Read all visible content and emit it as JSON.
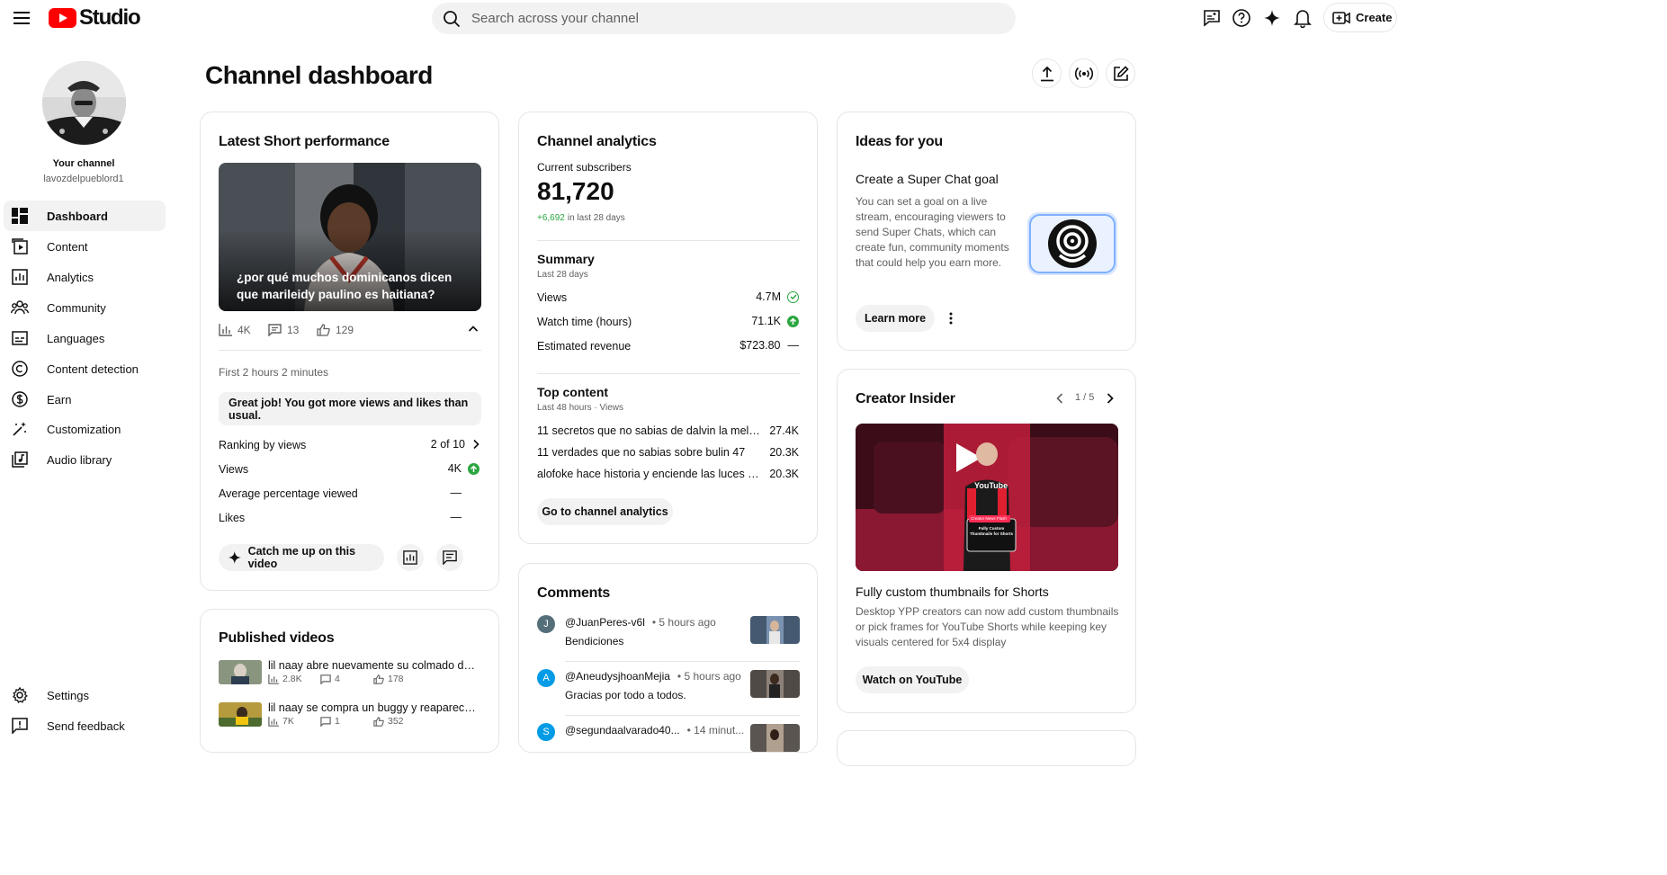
{
  "app": {
    "logo_text": "Studio"
  },
  "search": {
    "placeholder": "Search across your channel"
  },
  "header": {
    "create_label": "Create"
  },
  "sidebar": {
    "your_channel": "Your channel",
    "handle": "lavozdelpueblord1",
    "items": [
      {
        "label": "Dashboard",
        "icon": "dashboard-icon"
      },
      {
        "label": "Content",
        "icon": "content-icon"
      },
      {
        "label": "Analytics",
        "icon": "analytics-icon"
      },
      {
        "label": "Community",
        "icon": "community-icon"
      },
      {
        "label": "Languages",
        "icon": "subtitles-icon"
      },
      {
        "label": "Content detection",
        "icon": "copyright-icon"
      },
      {
        "label": "Earn",
        "icon": "dollar-icon"
      },
      {
        "label": "Customization",
        "icon": "magic-wand-icon"
      },
      {
        "label": "Audio library",
        "icon": "audio-library-icon"
      }
    ],
    "settings": "Settings",
    "feedback": "Send feedback"
  },
  "page": {
    "title": "Channel dashboard"
  },
  "latest_short": {
    "title": "Latest Short performance",
    "video_title": "¿por qué muchos dominicanos dicen que marileidy paulino es haitiana?",
    "views": "4K",
    "comments": "13",
    "likes": "129",
    "period": "First 2 hours 2 minutes",
    "banner": "Great job! You got more views and likes than usual.",
    "rows": [
      {
        "label": "Ranking by views",
        "value": "2 of 10"
      },
      {
        "label": "Views",
        "value": "4K"
      },
      {
        "label": "Average percentage viewed",
        "value": "—"
      },
      {
        "label": "Likes",
        "value": "—"
      }
    ],
    "catch_up": "Catch me up on this video"
  },
  "published": {
    "title": "Published videos",
    "videos": [
      {
        "title": "lil naay abre nuevamente su colmado despues de ...",
        "views": "2.8K",
        "comments": "4",
        "likes": "178"
      },
      {
        "title": "lil naay se compra un buggy y reaparece frente a ...",
        "views": "7K",
        "comments": "1",
        "likes": "352"
      }
    ]
  },
  "analytics": {
    "title": "Channel analytics",
    "subs_label": "Current subscribers",
    "subs_value": "81,720",
    "subs_change": "+6,692",
    "subs_change_period": "in last 28 days",
    "summary_title": "Summary",
    "summary_period": "Last 28 days",
    "summary": [
      {
        "label": "Views",
        "value": "4.7M",
        "status": "check"
      },
      {
        "label": "Watch time (hours)",
        "value": "71.1K",
        "status": "up"
      },
      {
        "label": "Estimated revenue",
        "value": "$723.80",
        "status": "—"
      }
    ],
    "top_title": "Top content",
    "top_period": "Last 48 hours · Views",
    "top": [
      {
        "title": "11 secretos que no sabias de dalvin la melodia",
        "value": "27.4K"
      },
      {
        "title": "11 verdades que no sabias sobre bulin 47",
        "value": "20.3K"
      },
      {
        "title": "alofoke hace historia y enciende las luces del estadio",
        "value": "20.3K"
      }
    ],
    "button": "Go to channel analytics"
  },
  "comments": {
    "title": "Comments",
    "items": [
      {
        "initial": "J",
        "author": "@JuanPeres-v6l",
        "time": "• 5 hours ago",
        "text": "Bendiciones",
        "color": "#546e7a"
      },
      {
        "initial": "A",
        "author": "@AneudysjhoanMejia",
        "time": "• 5 hours ago",
        "text": "Gracias por todo a todos.",
        "color": "#039be5"
      },
      {
        "initial": "S",
        "author": "@segundaalvarado40...",
        "time": "• 14 minut...",
        "text": "",
        "color": "#039be5"
      }
    ]
  },
  "ideas": {
    "title": "Ideas for you",
    "idea_title": "Create a Super Chat goal",
    "idea_text": "You can set a goal on a live stream, encouraging viewers to send Super Chats, which can create fun, community moments that could help you earn more.",
    "button": "Learn more"
  },
  "insider": {
    "title": "Creator Insider",
    "pager": "1 / 5",
    "video_title": "Fully custom thumbnails for Shorts",
    "video_text": "Desktop YPP creators can now add custom thumbnails or pick frames for YouTube Shorts while keeping key visuals centered for 5x4 display",
    "button": "Watch on YouTube",
    "thumb_badge": "Creator News Flash",
    "thumb_caption": "Fully Custom Thumbnails for Shorts",
    "thumb_shirt": "YouTube"
  }
}
